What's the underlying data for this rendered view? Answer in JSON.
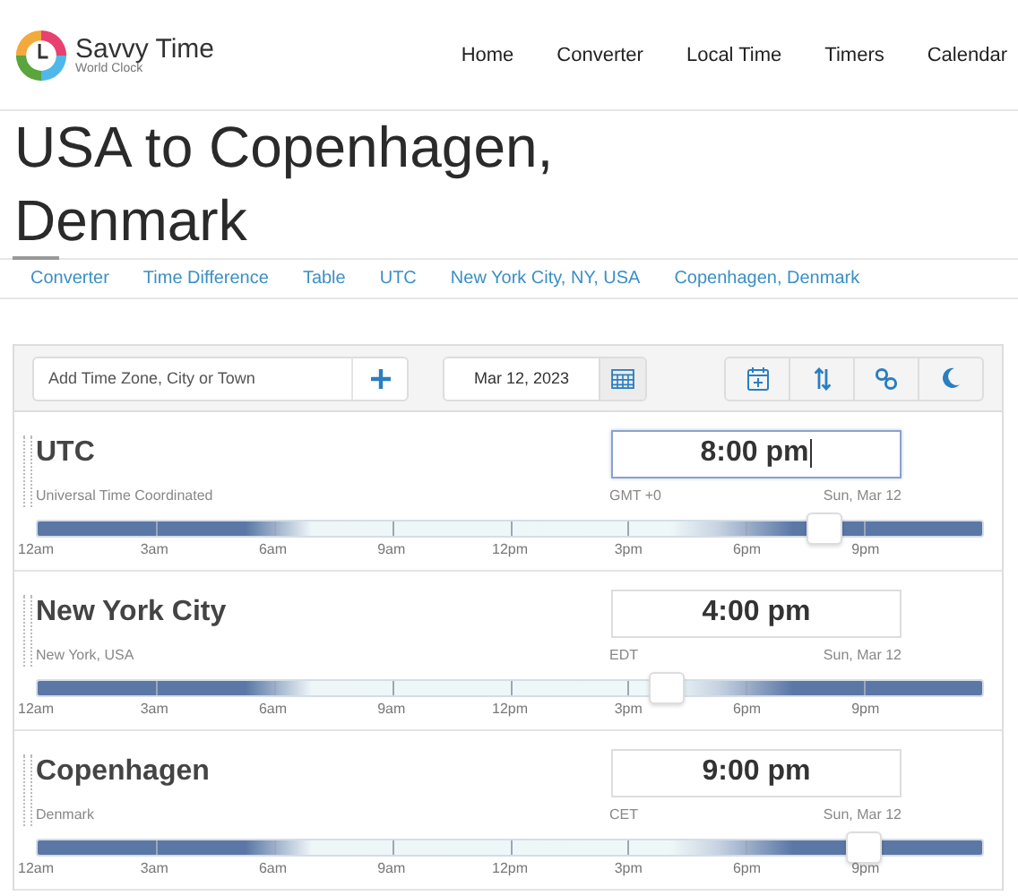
{
  "brand": {
    "name": "Savvy Time",
    "tagline": "World Clock"
  },
  "nav": [
    {
      "label": "Home"
    },
    {
      "label": "Converter"
    },
    {
      "label": "Local Time"
    },
    {
      "label": "Timers"
    },
    {
      "label": "Calendar"
    }
  ],
  "title": "USA to Copenhagen, Denmark",
  "tabs": [
    {
      "label": "Converter"
    },
    {
      "label": "Time Difference"
    },
    {
      "label": "Table"
    },
    {
      "label": "UTC"
    },
    {
      "label": "New York City, NY, USA"
    },
    {
      "label": "Copenhagen, Denmark"
    }
  ],
  "toolbar": {
    "search": {
      "placeholder": "Add Time Zone, City or Town"
    },
    "date": "Mar 12, 2023"
  },
  "zones": [
    {
      "name": "UTC",
      "location": "Universal Time Coordinated",
      "abbr": "GMT +0",
      "date": "Sun, Mar 12",
      "time": "8:00 pm",
      "focused": true,
      "level": 0.8333,
      "hour_labels": [
        "12am",
        "3am",
        "6am",
        "9am",
        "12pm",
        "3pm",
        "6pm",
        "9pm"
      ]
    },
    {
      "name": "New York City",
      "location": "New York, USA",
      "abbr": "EDT",
      "date": "Sun, Mar 12",
      "time": "4:00 pm",
      "focused": false,
      "level": 0.6667,
      "hour_labels": [
        "12am",
        "3am",
        "6am",
        "9am",
        "12pm",
        "3pm",
        "6pm",
        "9pm"
      ]
    },
    {
      "name": "Copenhagen",
      "location": "Denmark",
      "abbr": "CET",
      "date": "Sun, Mar 12",
      "time": "9:00 pm",
      "focused": false,
      "level": 0.875,
      "hour_labels": [
        "12am",
        "3am",
        "6am",
        "9am",
        "12pm",
        "3pm",
        "6pm",
        "9pm"
      ]
    }
  ]
}
